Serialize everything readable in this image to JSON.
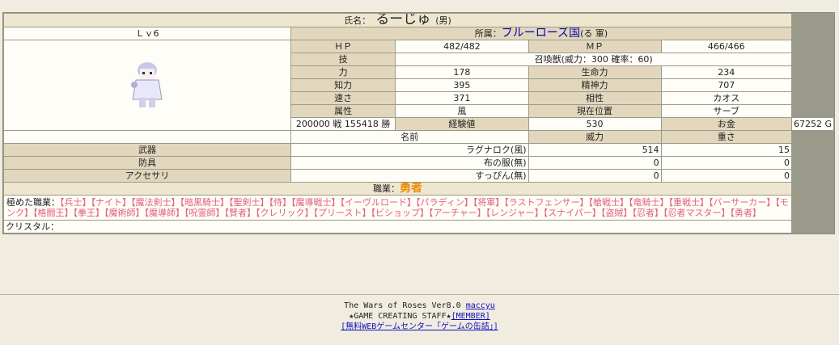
{
  "header": {
    "name_label": "氏名：",
    "name": "るーじゅ",
    "gender": "(男)"
  },
  "level": "Ｌｖ6",
  "affiliation": {
    "label": "所属：",
    "country": "ブルーローズ国",
    "army": "(る 軍)"
  },
  "stats": {
    "hp_label": "ＨＰ",
    "hp": "482/482",
    "mp_label": "ＭＰ",
    "mp": "466/466",
    "skill_label": "技",
    "skill": "召喚獣(威力：300 確率：60)",
    "str_label": "力",
    "str": "178",
    "vit_label": "生命力",
    "vit": "234",
    "int_label": "知力",
    "int": "395",
    "spi_label": "精神力",
    "spi": "707",
    "spd_label": "速さ",
    "spd": "371",
    "aff_label": "相性",
    "aff": "カオス",
    "elem_label": "属性",
    "elem": "風",
    "loc_label": "現在位置",
    "loc": "サーブ",
    "exp_label": "経験値",
    "exp": "530",
    "gold_label": "お金",
    "gold": "67252 G"
  },
  "record": "200000 戦 155418 勝",
  "equip_header": {
    "name": "名前",
    "power": "威力",
    "weight": "重さ"
  },
  "equipment": [
    {
      "slot": "武器",
      "name": "ラグナロク(風)",
      "power": "514",
      "weight": "15"
    },
    {
      "slot": "防具",
      "name": "布の服(無)",
      "power": "0",
      "weight": "0"
    },
    {
      "slot": "アクセサリ",
      "name": "すっぴん(無)",
      "power": "0",
      "weight": "0"
    }
  ],
  "job": {
    "label": "職業：",
    "value": "勇者"
  },
  "mastered": {
    "label": "極めた職業：",
    "jobs": "【兵士】【ナイト】【魔法剣士】【暗黒騎士】【聖剣士】【侍】【魔導戦士】【イーヴルロード】【パラディン】【将軍】【ラストフェンサー】【槍戦士】【竜騎士】【重戦士】【バーサーカー】【モンク】【格闘王】【拳王】【魔術師】【魔導師】【呪霊師】【賢者】【クレリック】【プリースト】【ビショップ】【アーチャー】【レンジャー】【スナイパー】【盗賊】【忍者】【忍者マスター】【勇者】"
  },
  "crystal": "クリスタル：",
  "footer": {
    "title": "The Wars of Roses Ver8.0",
    "author_link": "maccyu",
    "staff": "★GAME CREATING STAFF★",
    "member_link": "[MEMBER]",
    "center_link": "[無料WEBゲームセンター「ゲームの缶詰」]"
  }
}
